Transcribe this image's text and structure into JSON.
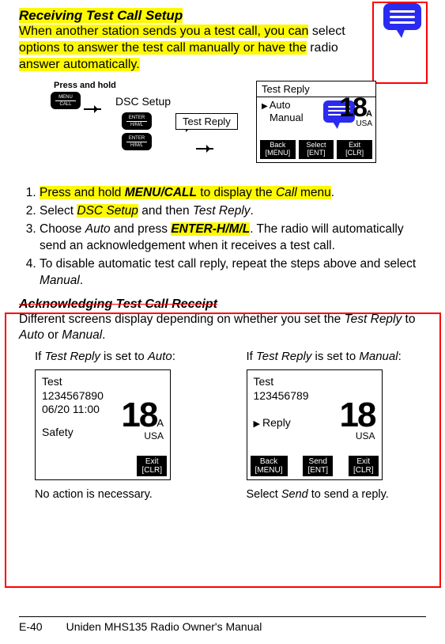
{
  "header": {
    "title": "Receiving Test Call Setup",
    "intro_hl1": "When another station sends you a test call, you can",
    "intro_plain1": " select ",
    "intro_hl2": "options to answer the test call manually or have the",
    "intro_plain2": " radio ",
    "intro_hl3": "answer automatically."
  },
  "flow": {
    "press_hold": "Press and hold",
    "menu_top": "MENU",
    "menu_bottom": "CALL",
    "dsc_setup": "DSC Setup",
    "enter_top": "ENTER",
    "enter_bottom": "H/M/L",
    "test_reply": "Test Reply"
  },
  "lcd1": {
    "title": "Test Reply",
    "opt1": "Auto",
    "opt2": "Manual",
    "ch_big": "18",
    "ch_sub": "A",
    "ch_usa": "USA",
    "btn1_top": "Back",
    "btn1_bot": "[MENU]",
    "btn2_top": "Select",
    "btn2_bot": "[ENT]",
    "btn3_top": "Exit",
    "btn3_bot": "[CLR]"
  },
  "steps": {
    "s1a": "Press and hold ",
    "s1b": "MENU/CALL",
    "s1c": " to display the ",
    "s1d": "Call",
    "s1e": " menu",
    "s1f": ".",
    "s2a": "Select ",
    "s2b": "DSC Setup",
    "s2c": " and then ",
    "s2d": "Test Reply",
    "s2e": ".",
    "s3a": "Choose ",
    "s3b": "Auto",
    "s3c": " and press ",
    "s3d": "ENTER-H/M/L",
    "s3e": ". The radio will automatically send an acknowledgement when it receives a test call.",
    "s4a": "To disable automatic test call reply, repeat the steps above and select ",
    "s4b": "Manual",
    "s4c": "."
  },
  "ack": {
    "title": "Acknowledging Test Call Receipt",
    "desc1": "Different screens display depending on whether you set the ",
    "desc2": "Test Reply",
    "desc3": " to ",
    "desc4": "Auto",
    "desc5": " or ",
    "desc6": "Manual",
    "desc7": "."
  },
  "cols": {
    "auto_cap_a": "If ",
    "auto_cap_b": "Test Reply",
    "auto_cap_c": " is set to ",
    "auto_cap_d": "Auto",
    "auto_cap_e": ":",
    "manual_cap_a": "If ",
    "manual_cap_b": "Test Reply",
    "manual_cap_c": " is set to ",
    "manual_cap_d": "Manual",
    "manual_cap_e": ":",
    "auto_caption": "No action is necessary.",
    "manual_caption_a": "Select ",
    "manual_caption_b": "Send",
    "manual_caption_c": " to send a reply."
  },
  "lcd_auto": {
    "l1": "Test",
    "l2": "1234567890",
    "l3": "06/20  11:00",
    "safety": "Safety",
    "big": "18",
    "sub": "A",
    "usa": "USA",
    "exit_top": "Exit",
    "exit_bot": "[CLR]"
  },
  "lcd_manual": {
    "l1": "Test",
    "l2": "123456789",
    "reply": "Reply",
    "big": "18",
    "usa": "USA",
    "b1t": "Back",
    "b1b": "[MENU]",
    "b2t": "Send",
    "b2b": "[ENT]",
    "b3t": "Exit",
    "b3b": "[CLR]"
  },
  "footer": {
    "page": "E-40",
    "text": "Uniden MHS135 Radio Owner's Manual"
  }
}
